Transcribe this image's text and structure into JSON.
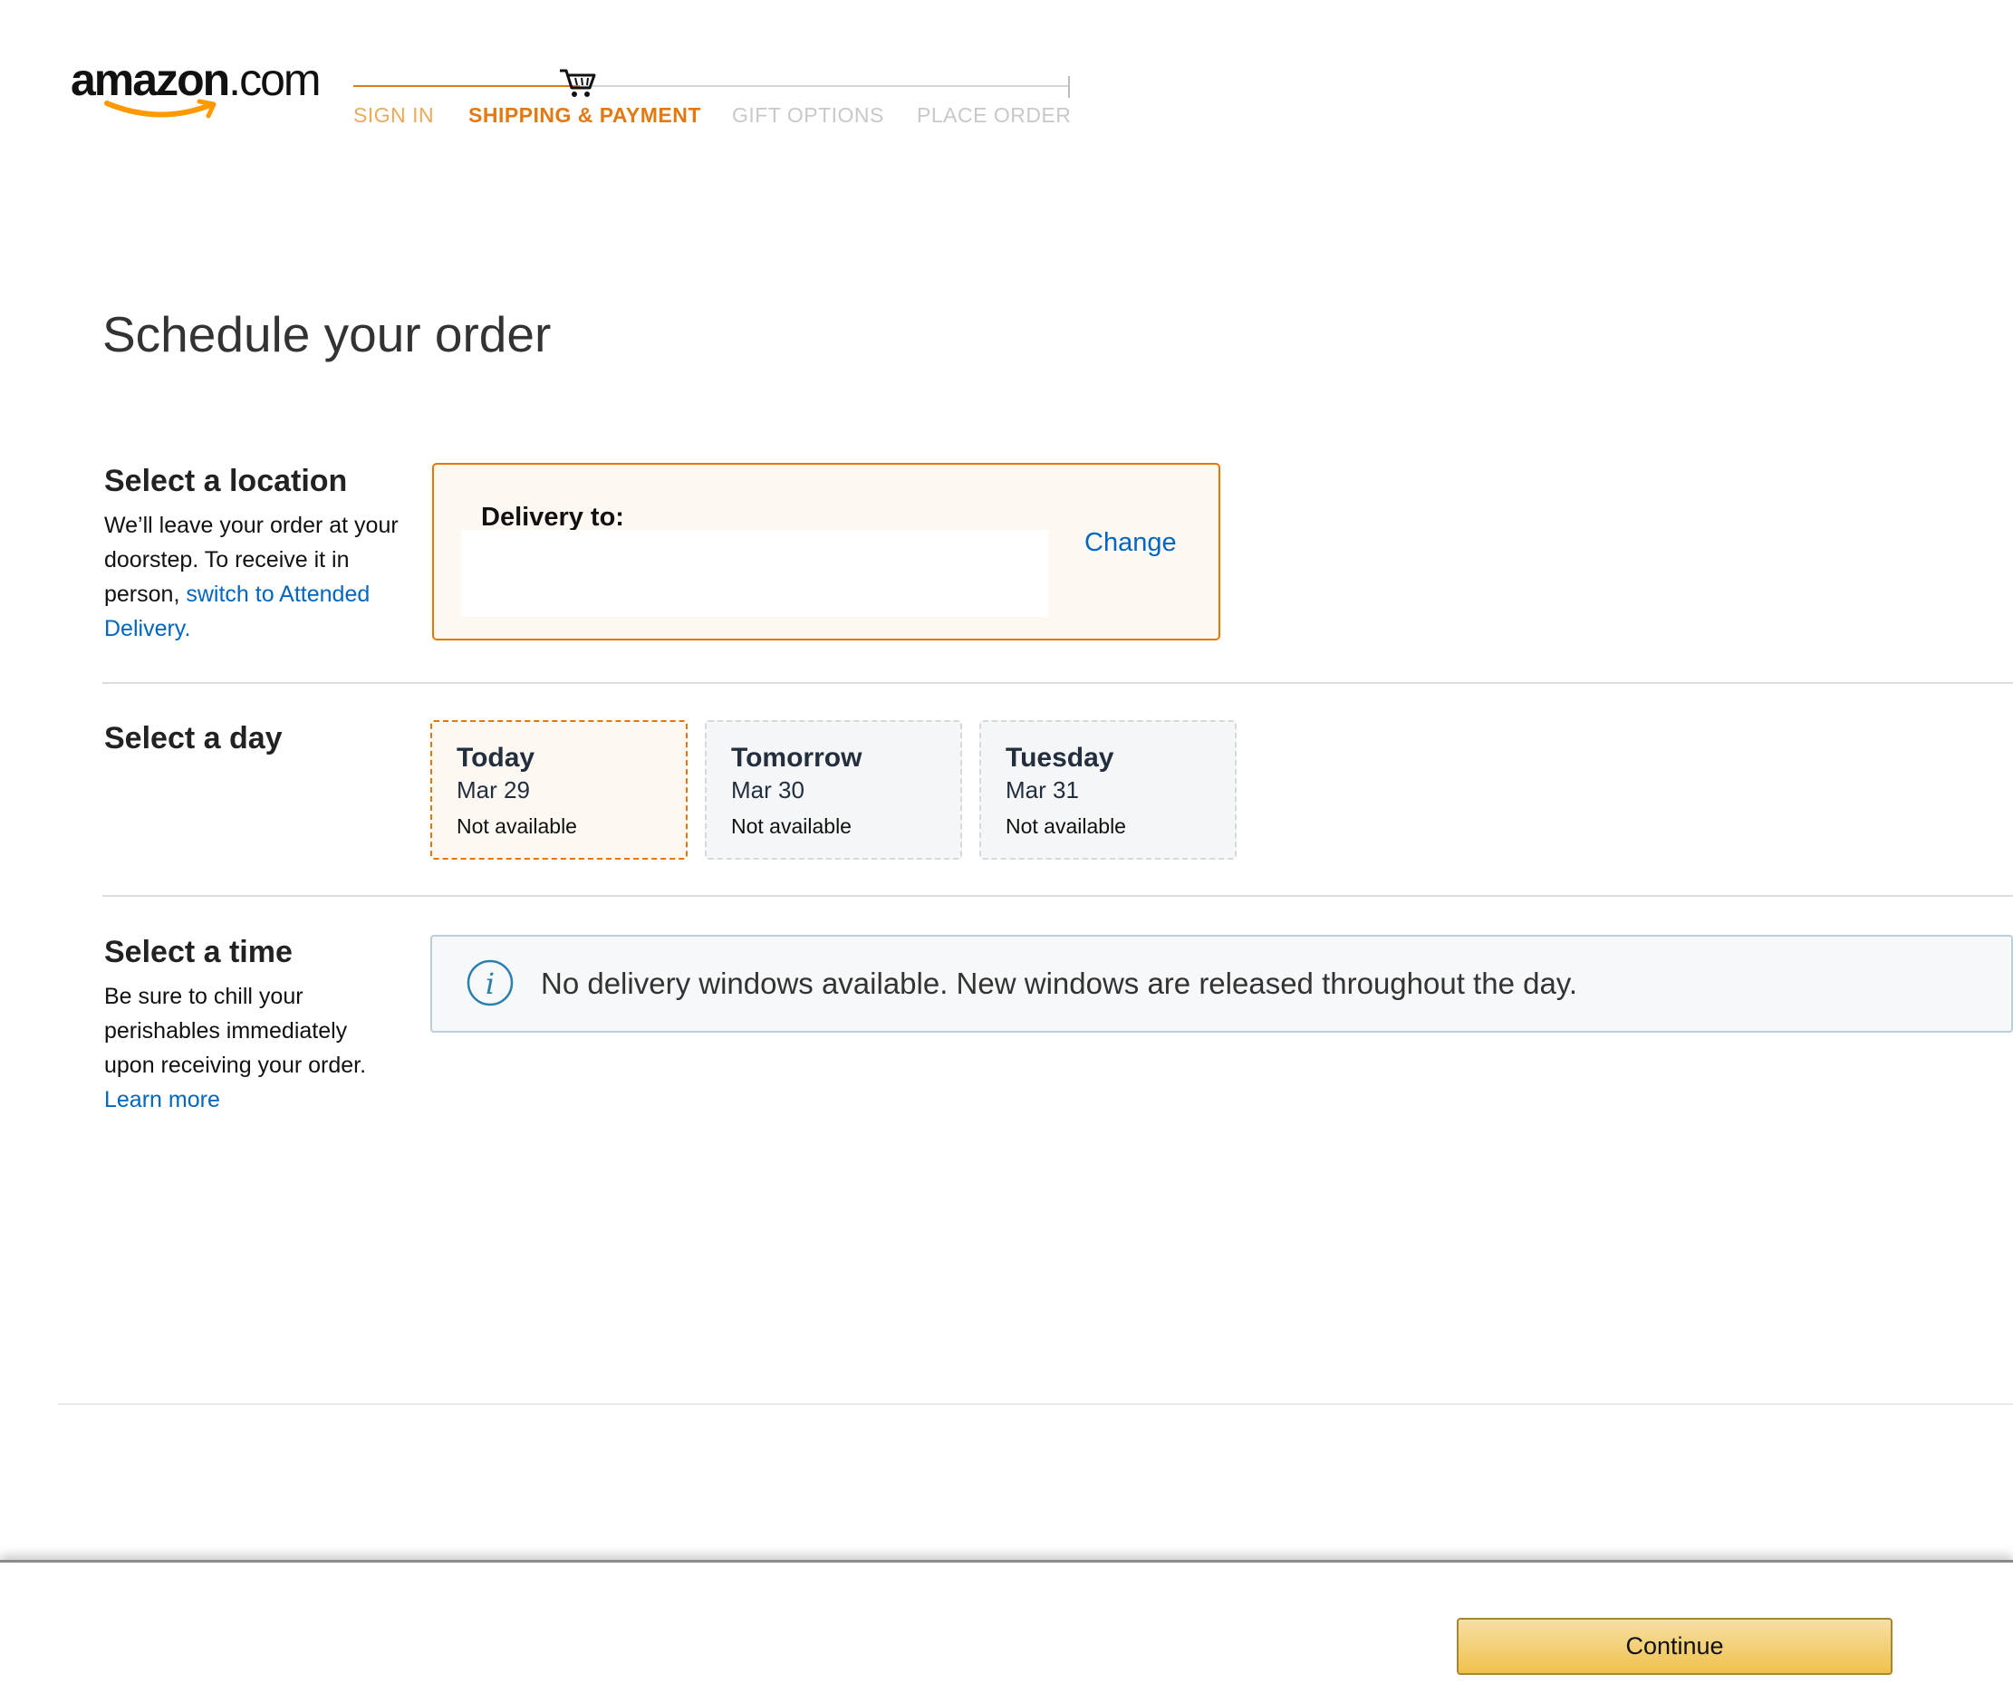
{
  "header": {
    "logo": {
      "text_main": "amazon",
      "text_suffix": ".com"
    },
    "checkout_steps": [
      {
        "label": "SIGN IN",
        "state": "done"
      },
      {
        "label": "SHIPPING & PAYMENT",
        "state": "active"
      },
      {
        "label": "GIFT OPTIONS",
        "state": "todo"
      },
      {
        "label": "PLACE ORDER",
        "state": "todo"
      }
    ],
    "icon": "shopping-cart-icon"
  },
  "page_title": "Schedule your order",
  "location": {
    "heading": "Select a location",
    "description_prefix": "We’ll leave your order at your doorstep. To receive it in person, ",
    "description_link": "switch to Attended Delivery.",
    "delivery_label": "Delivery to:",
    "change_link": "Change"
  },
  "day": {
    "heading": "Select a day",
    "options": [
      {
        "name": "Today",
        "date": "Mar 29",
        "status": "Not available",
        "selected": true
      },
      {
        "name": "Tomorrow",
        "date": "Mar 30",
        "status": "Not available",
        "selected": false
      },
      {
        "name": "Tuesday",
        "date": "Mar 31",
        "status": "Not available",
        "selected": false
      }
    ]
  },
  "time": {
    "heading": "Select a time",
    "description": "Be sure to chill your perishables immediately upon receiving your order.",
    "learn_more": "Learn more",
    "alert_icon": "info-icon",
    "alert_text": "No delivery windows available. New windows are released throughout the day."
  },
  "footer": {
    "continue_label": "Continue"
  },
  "colors": {
    "accent_orange": "#e47911",
    "link_blue": "#0066c0",
    "selected_bg": "#fdf8f2",
    "button_gold": "#f0c14b"
  }
}
